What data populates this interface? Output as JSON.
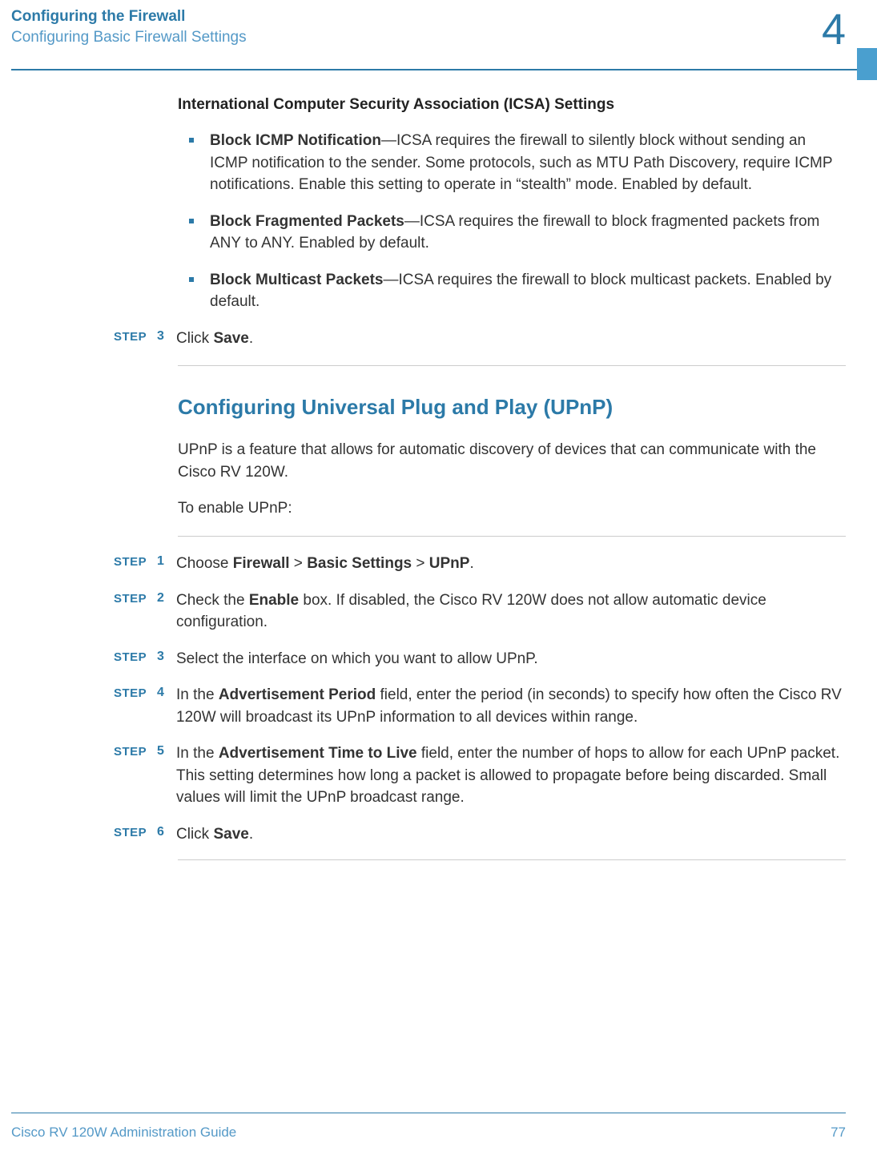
{
  "header": {
    "title": "Configuring the Firewall",
    "subtitle": "Configuring Basic Firewall Settings",
    "chapter_number": "4"
  },
  "section1": {
    "heading": "International Computer Security Association (ICSA) Settings",
    "bullets": [
      {
        "bold": "Block ICMP Notification",
        "rest": "—ICSA requires the firewall to silently block without sending an ICMP notification to the sender. Some protocols, such as MTU Path Discovery, require ICMP notifications. Enable this setting to operate in “stealth” mode. Enabled by default."
      },
      {
        "bold": "Block Fragmented Packets",
        "rest": "—ICSA requires the firewall to block fragmented packets from ANY to ANY. Enabled by default."
      },
      {
        "bold": "Block Multicast Packets",
        "rest": "—ICSA requires the firewall to block multicast packets. Enabled by default."
      }
    ]
  },
  "step_label": "STEP",
  "step3_top": {
    "num": "3",
    "prefix": "Click ",
    "bold": "Save",
    "suffix": "."
  },
  "section2": {
    "heading": "Configuring Universal Plug and Play (UPnP)",
    "para1": "UPnP is a feature that allows for automatic discovery of devices that can communicate with the Cisco RV 120W.",
    "para2": "To enable UPnP:"
  },
  "steps2": [
    {
      "num": "1",
      "segments": [
        {
          "text": "Choose ",
          "bold": false
        },
        {
          "text": "Firewall",
          "bold": true
        },
        {
          "text": " > ",
          "bold": false
        },
        {
          "text": "Basic Settings",
          "bold": true
        },
        {
          "text": " > ",
          "bold": false
        },
        {
          "text": "UPnP",
          "bold": true
        },
        {
          "text": ".",
          "bold": false
        }
      ]
    },
    {
      "num": "2",
      "segments": [
        {
          "text": "Check the ",
          "bold": false
        },
        {
          "text": "Enable",
          "bold": true
        },
        {
          "text": " box. If disabled, the Cisco RV 120W does not allow automatic device configuration.",
          "bold": false
        }
      ]
    },
    {
      "num": "3",
      "segments": [
        {
          "text": "Select the interface on which you want to allow UPnP.",
          "bold": false
        }
      ]
    },
    {
      "num": "4",
      "segments": [
        {
          "text": "In the ",
          "bold": false
        },
        {
          "text": "Advertisement Period",
          "bold": true
        },
        {
          "text": " field, enter the period (in seconds) to specify how often the Cisco RV 120W will broadcast its UPnP information to all devices within range.",
          "bold": false
        }
      ]
    },
    {
      "num": "5",
      "segments": [
        {
          "text": "In the ",
          "bold": false
        },
        {
          "text": "Advertisement Time to Live",
          "bold": true
        },
        {
          "text": " field, enter the number of hops to allow for each UPnP packet. This setting determines how long a packet is allowed to propagate before being discarded. Small values will limit the UPnP broadcast range.",
          "bold": false
        }
      ]
    },
    {
      "num": "6",
      "segments": [
        {
          "text": "Click ",
          "bold": false
        },
        {
          "text": "Save",
          "bold": true
        },
        {
          "text": ".",
          "bold": false
        }
      ]
    }
  ],
  "footer": {
    "text": "Cisco RV 120W Administration Guide",
    "page": "77"
  }
}
